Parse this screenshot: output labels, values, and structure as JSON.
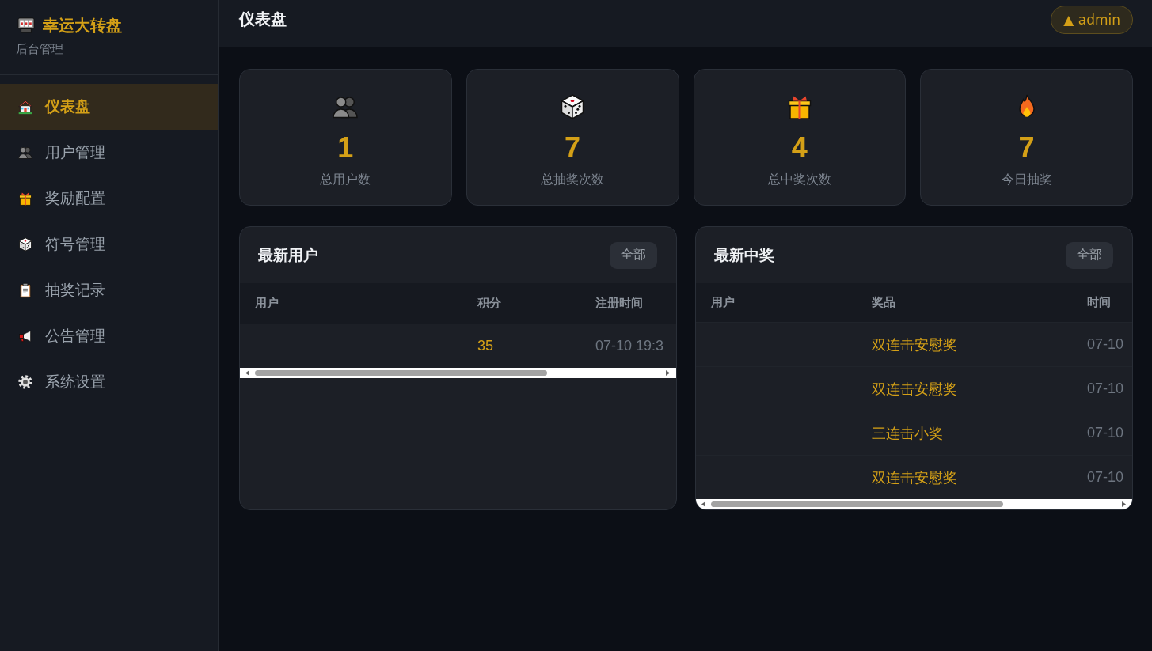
{
  "sidebar": {
    "brand": {
      "title": "幸运大转盘",
      "subtitle": "后台管理"
    },
    "items": [
      {
        "label": "仪表盘",
        "selected": true
      },
      {
        "label": "用户管理",
        "selected": false
      },
      {
        "label": "奖励配置",
        "selected": false
      },
      {
        "label": "符号管理",
        "selected": false
      },
      {
        "label": "抽奖记录",
        "selected": false
      },
      {
        "label": "公告管理",
        "selected": false
      },
      {
        "label": "系统设置",
        "selected": false
      }
    ]
  },
  "header": {
    "title": "仪表盘",
    "user_badge": "▲ admin"
  },
  "stats": [
    {
      "value": "1",
      "label": "总用户数"
    },
    {
      "value": "7",
      "label": "总抽奖次数"
    },
    {
      "value": "4",
      "label": "总中奖次数"
    },
    {
      "value": "7",
      "label": "今日抽奖"
    }
  ],
  "panels": [
    {
      "kind": "users",
      "title": "最新用户",
      "action": "全部",
      "columns": [
        "用户",
        "积分",
        "注册时间"
      ],
      "rows": [
        {
          "points": "35",
          "registered": "07-10 19:3"
        }
      ]
    },
    {
      "kind": "wins",
      "title": "最新中奖",
      "action": "全部",
      "columns": [
        "用户",
        "奖品",
        "时间"
      ],
      "rows": [
        {
          "prize": "双连击安慰奖",
          "time": "07-10"
        },
        {
          "prize": "双连击安慰奖",
          "time": "07-10"
        },
        {
          "prize": "三连击小奖",
          "time": "07-10"
        },
        {
          "prize": "双连击安慰奖",
          "time": "07-10"
        }
      ]
    }
  ]
}
